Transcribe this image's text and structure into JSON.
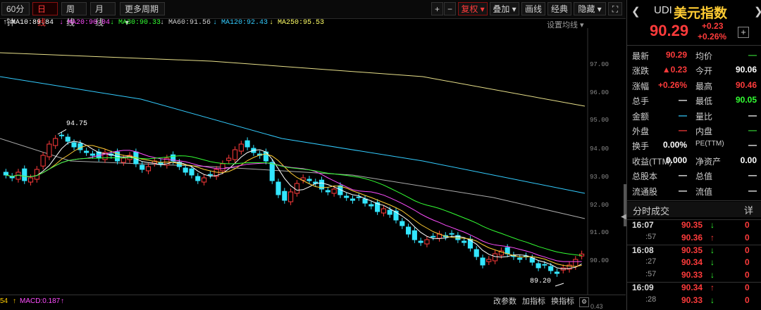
{
  "toolbar": {
    "tabs": [
      "60分钟",
      "日线",
      "周线",
      "月线",
      "更多周期 ▾"
    ],
    "active_tab": "日线",
    "buttons": [
      "+",
      "−",
      "复权 ▾",
      "叠加 ▾",
      "画线",
      "经典",
      "隐藏 ▾",
      "⛶"
    ]
  },
  "ma_legend": [
    {
      "label": "MA10:89.84",
      "arrow": "↑",
      "color": "#ffffff"
    },
    {
      "label": "MA20:90.04",
      "arrow": "↓",
      "color": "#ff4dff"
    },
    {
      "label": "MA30:90.33",
      "arrow": "↓",
      "color": "#33ff33"
    },
    {
      "label": "MA60:91.56",
      "arrow": "↓",
      "color": "#cfcfcf"
    },
    {
      "label": "MA120:92.43",
      "arrow": "↓",
      "color": "#33ccff"
    },
    {
      "label": "MA250:95.53",
      "arrow": "↓",
      "color": "#ffff66"
    }
  ],
  "set_ma": "设置均线 ▾",
  "price_axis": [
    "97.00",
    "96.00",
    "95.00",
    "94.00",
    "93.00",
    "92.00",
    "91.00",
    "90.00"
  ],
  "annotations": {
    "high": "94.75",
    "low": "89.20"
  },
  "bottom": {
    "left_value": "54",
    "macd": "MACD:0.187",
    "macd_arrow": "↑",
    "buttons": [
      "改参数",
      "加指标",
      "换指标"
    ],
    "axis_value": "0.43"
  },
  "quote": {
    "code": "UDI",
    "name": "美元指数",
    "price": "90.29",
    "change": "+0.23",
    "pct": "+0.26%",
    "fields": [
      {
        "l1": "最新",
        "v1": "90.29",
        "c1": "#ff3b3b",
        "l2": "均价",
        "v2": "—",
        "c2": "#33cc33"
      },
      {
        "l1": "涨跌",
        "v1": "▲0.23",
        "c1": "#ff3b3b",
        "l2": "今开",
        "v2": "90.06",
        "c2": "#ffffff"
      },
      {
        "l1": "涨幅",
        "v1": "+0.26%",
        "c1": "#ff3b3b",
        "l2": "最高",
        "v2": "90.46",
        "c2": "#ff3b3b"
      },
      {
        "l1": "总手",
        "v1": "—",
        "c1": "#ffffff",
        "l2": "最低",
        "v2": "90.05",
        "c2": "#33ff33"
      },
      {
        "l1": "金额",
        "v1": "—",
        "c1": "#33ccff",
        "l2": "量比",
        "v2": "—",
        "c2": "#ffffff"
      },
      {
        "l1": "外盘",
        "v1": "—",
        "c1": "#ff3b3b",
        "l2": "内盘",
        "v2": "—",
        "c2": "#33cc33"
      },
      {
        "l1": "换手",
        "v1": "0.00%",
        "c1": "#ffffff",
        "l2": "PE(TTM)",
        "v2": "—",
        "c2": "#ffffff"
      },
      {
        "l1": "收益(TTM)",
        "v1": "0.000",
        "c1": "#ffffff",
        "l2": "净资产",
        "v2": "0.00",
        "c2": "#ffffff"
      },
      {
        "l1": "总股本",
        "v1": "—",
        "c1": "#ffffff",
        "l2": "总值",
        "v2": "—",
        "c2": "#ffffff"
      },
      {
        "l1": "流通股",
        "v1": "—",
        "c1": "#ffffff",
        "l2": "流值",
        "v2": "—",
        "c2": "#ffffff"
      }
    ],
    "trades_title": "分时成交",
    "trades_btn": "详",
    "trades": [
      {
        "t": "16:07",
        "p": "90.35",
        "a": "↓",
        "ac": "#33ff33",
        "v": "0"
      },
      {
        "t": ":57",
        "p": "90.36",
        "a": "↑",
        "ac": "#ff3b3b",
        "v": "0"
      },
      {
        "t": "16:08",
        "p": "90.35",
        "a": "↓",
        "ac": "#33ff33",
        "v": "0"
      },
      {
        "t": ":27",
        "p": "90.34",
        "a": "↓",
        "ac": "#33ff33",
        "v": "0"
      },
      {
        "t": ":57",
        "p": "90.33",
        "a": "↓",
        "ac": "#33ff33",
        "v": "0"
      },
      {
        "t": "16:09",
        "p": "90.34",
        "a": "↑",
        "ac": "#ff3b3b",
        "v": "0"
      },
      {
        "t": ":28",
        "p": "90.33",
        "a": "↓",
        "ac": "#33ff33",
        "v": "0"
      }
    ]
  }
}
